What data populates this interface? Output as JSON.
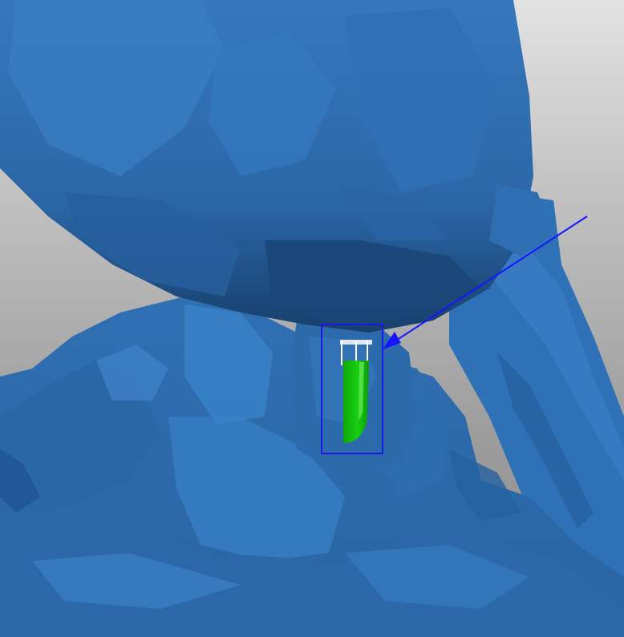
{
  "scene": {
    "background_top": "#e2e2e2",
    "background_bottom": "#8e8e8e",
    "model_color": "#2e6db0",
    "model_shadow_color": "#1c4a7d",
    "model_highlight_color": "#4b8fd0",
    "support_color": "#16c80f",
    "support_highlight_color": "#7cf36f",
    "selection_color": "#1a1ae6",
    "arrow_color": "#1515ff"
  },
  "annotations": {
    "selection_box": {
      "shape": "rectangle",
      "icon": "selection-box"
    },
    "pointer": {
      "shape": "arrow",
      "icon": "arrow-icon"
    }
  }
}
